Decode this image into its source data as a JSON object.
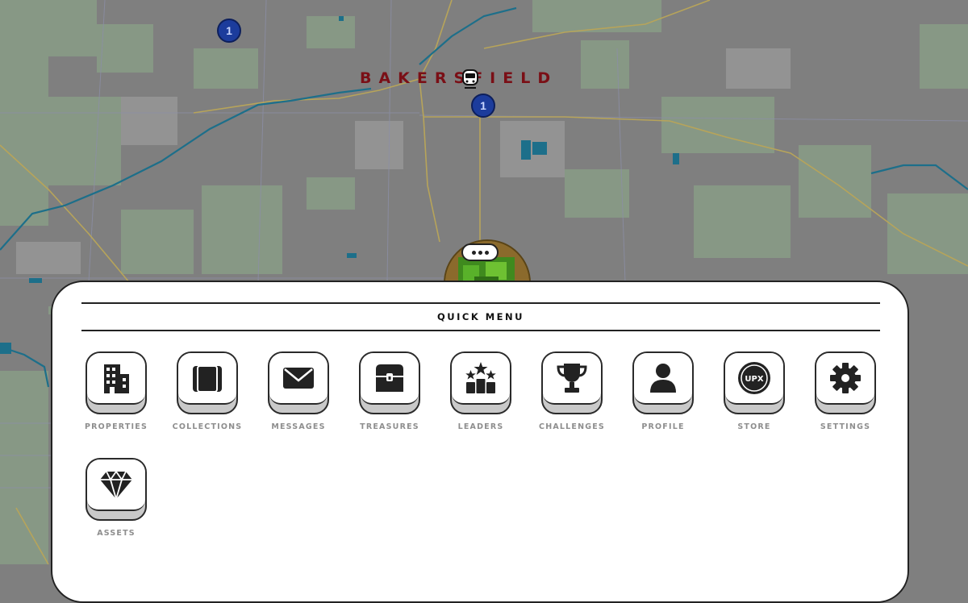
{
  "map": {
    "city_label": "BAKERSFIELD",
    "markers": [
      {
        "count": "1"
      },
      {
        "count": "1"
      }
    ]
  },
  "quick_menu": {
    "title": "QUICK MENU",
    "items": [
      {
        "label": "PROPERTIES",
        "icon": "building-icon"
      },
      {
        "label": "COLLECTIONS",
        "icon": "collections-icon"
      },
      {
        "label": "MESSAGES",
        "icon": "envelope-icon"
      },
      {
        "label": "TREASURES",
        "icon": "treasure-chest-icon"
      },
      {
        "label": "LEADERS",
        "icon": "leaderboard-stars-icon"
      },
      {
        "label": "CHALLENGES",
        "icon": "trophy-icon"
      },
      {
        "label": "PROFILE",
        "icon": "person-icon"
      },
      {
        "label": "STORE",
        "icon": "upx-coin-icon",
        "coin_text": "UPX"
      },
      {
        "label": "SETTINGS",
        "icon": "gear-icon"
      },
      {
        "label": "ASSETS",
        "icon": "diamond-icon"
      }
    ]
  },
  "colors": {
    "map_bg": "#7f7f7f",
    "map_green": "#889b86",
    "water": "#1d6f8a",
    "roads": "#b7a45a",
    "city_label": "#7a0f16",
    "marker": "#1c3c9c",
    "icon": "#222222",
    "label": "#8e8e8e"
  }
}
